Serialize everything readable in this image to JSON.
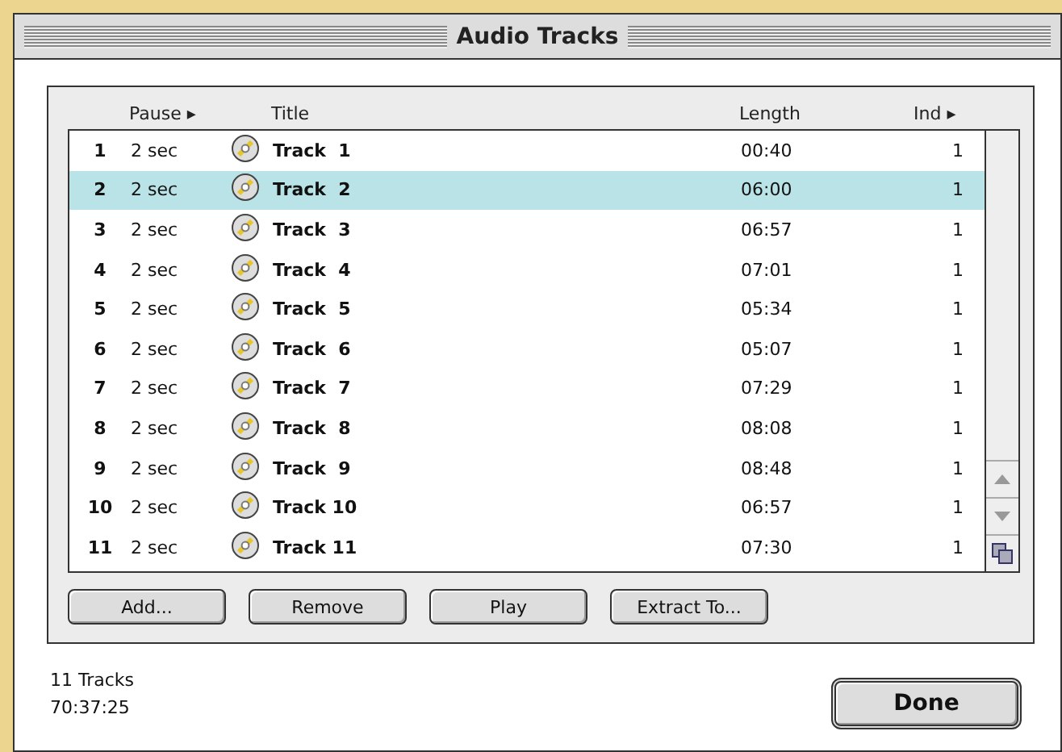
{
  "window": {
    "title": "Audio Tracks"
  },
  "table": {
    "columns": [
      "Pause ▸",
      "Title",
      "Length",
      "Ind ▸"
    ],
    "rows": [
      {
        "number": "1",
        "pause": "2 sec",
        "title": "Track  1",
        "length": "00:40",
        "index": "1",
        "selected": false
      },
      {
        "number": "2",
        "pause": "2 sec",
        "title": "Track  2",
        "length": "06:00",
        "index": "1",
        "selected": true
      },
      {
        "number": "3",
        "pause": "2 sec",
        "title": "Track  3",
        "length": "06:57",
        "index": "1",
        "selected": false
      },
      {
        "number": "4",
        "pause": "2 sec",
        "title": "Track  4",
        "length": "07:01",
        "index": "1",
        "selected": false
      },
      {
        "number": "5",
        "pause": "2 sec",
        "title": "Track  5",
        "length": "05:34",
        "index": "1",
        "selected": false
      },
      {
        "number": "6",
        "pause": "2 sec",
        "title": "Track  6",
        "length": "05:07",
        "index": "1",
        "selected": false
      },
      {
        "number": "7",
        "pause": "2 sec",
        "title": "Track  7",
        "length": "07:29",
        "index": "1",
        "selected": false
      },
      {
        "number": "8",
        "pause": "2 sec",
        "title": "Track  8",
        "length": "08:08",
        "index": "1",
        "selected": false
      },
      {
        "number": "9",
        "pause": "2 sec",
        "title": "Track  9",
        "length": "08:48",
        "index": "1",
        "selected": false
      },
      {
        "number": "10",
        "pause": "2 sec",
        "title": "Track 10",
        "length": "06:57",
        "index": "1",
        "selected": false
      },
      {
        "number": "11",
        "pause": "2 sec",
        "title": "Track 11",
        "length": "07:30",
        "index": "1",
        "selected": false
      }
    ]
  },
  "buttons": [
    "Add...",
    "Remove",
    "Play",
    "Extract To..."
  ],
  "summary": {
    "count": "11 Tracks",
    "total": "70:37:25"
  },
  "done_button": "Done"
}
